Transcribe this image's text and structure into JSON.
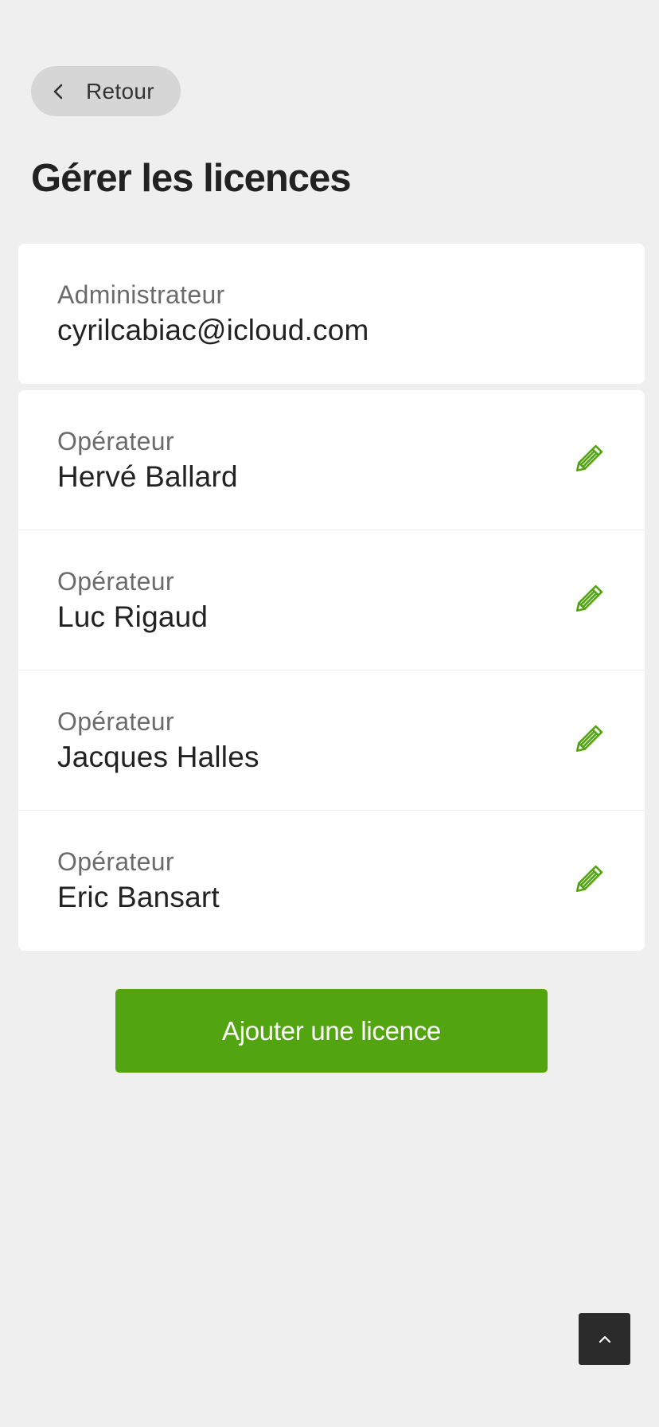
{
  "back": {
    "label": "Retour",
    "icon": "chevron-left-icon"
  },
  "page": {
    "title": "Gérer les licences"
  },
  "admin": {
    "role": "Administrateur",
    "value": "cyrilcabiac@icloud.com"
  },
  "operators": [
    {
      "role": "Opérateur",
      "name": "Hervé Ballard",
      "icon": "pencil-icon"
    },
    {
      "role": "Opérateur",
      "name": "Luc Rigaud",
      "icon": "pencil-icon"
    },
    {
      "role": "Opérateur",
      "name": "Jacques Halles",
      "icon": "pencil-icon"
    },
    {
      "role": "Opérateur",
      "name": "Eric Bansart",
      "icon": "pencil-icon"
    }
  ],
  "actions": {
    "add_label": "Ajouter une licence"
  },
  "scroll_top": {
    "icon": "chevron-up-icon"
  },
  "colors": {
    "background": "#efefef",
    "accent": "#52a511",
    "pencil": "#52a511",
    "text": "#222222",
    "muted": "#6b6b6b",
    "scroll_button": "#2b2b2b"
  }
}
